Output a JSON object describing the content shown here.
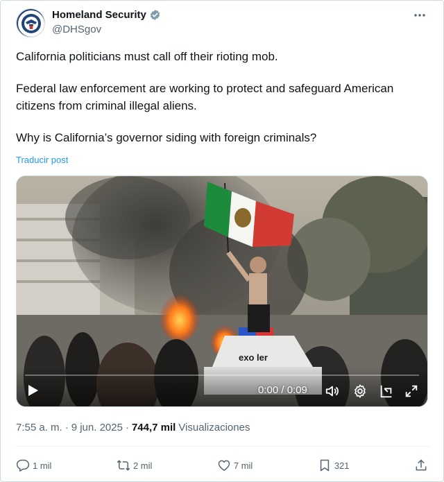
{
  "account": {
    "name": "Homeland Security",
    "handle": "@DHSgov",
    "avatar_icon": "dhs-seal-icon",
    "verified_icon": "verified-badge-icon",
    "verified_color": "#829aab"
  },
  "post": {
    "line1": "California politicians must call off their rioting mob.",
    "line2a": "Federal law enforcement are working to protect and safeguard American",
    "line2b": "citizens from criminal illegal aliens.",
    "line3": "Why is California’s governor siding with foreign criminals?",
    "translate_label": "Traducir post"
  },
  "video": {
    "time": "0:00 / 0:09",
    "progress": 0,
    "car_text": "exo ler",
    "icons": [
      "play-icon",
      "volume-icon",
      "settings-icon",
      "pip-icon",
      "fullscreen-icon"
    ]
  },
  "meta": {
    "time": "7:55 a. m.",
    "sep1": "·",
    "date": "9 jun. 2025",
    "sep2": "·",
    "views_count": "744,7 mil",
    "views_label": "Visualizaciones"
  },
  "actions": {
    "replies": "1 mil",
    "reposts": "2 mil",
    "likes": "7 mil",
    "bookmarks": "321"
  },
  "colors": {
    "accent": "#1d9bf0",
    "muted": "#536471",
    "text": "#0f1419"
  }
}
